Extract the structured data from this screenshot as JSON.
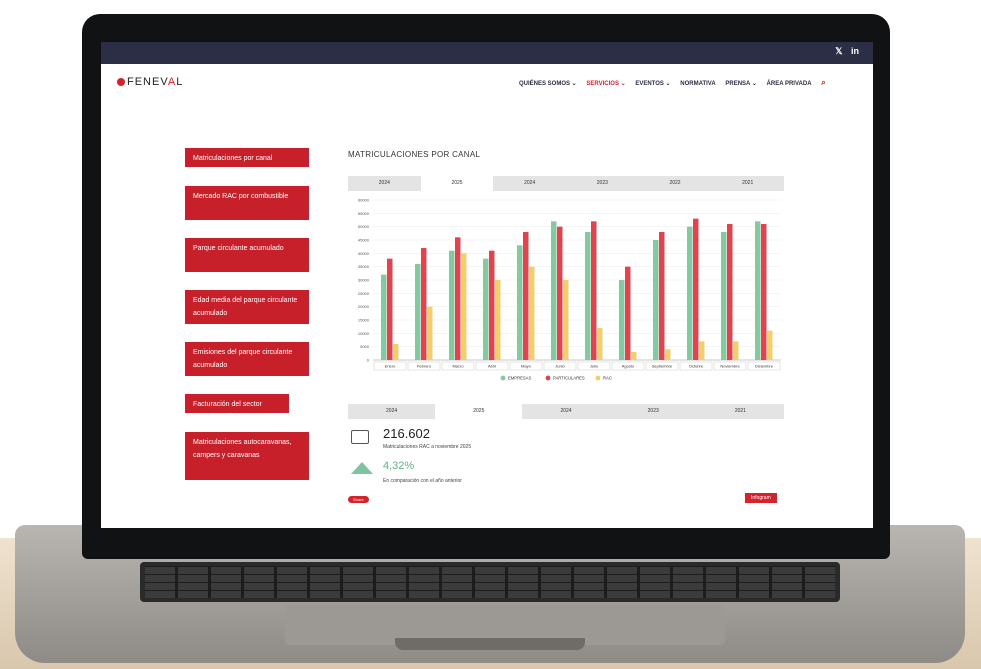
{
  "header": {
    "logo_mark": "●",
    "logo_text_1": "FENEV",
    "logo_text_a": "A",
    "logo_text_2": "L",
    "nav": [
      "QUIÉNES SOMOS ⌄",
      "SERVICIOS ⌄",
      "EVENTOS ⌄",
      "NORMATIVA",
      "PRENSA ⌄",
      "ÁREA PRIVADA",
      "⌕"
    ],
    "nav_active_index": 1
  },
  "social": [
    "𝕏",
    "in"
  ],
  "sidebar": {
    "items": [
      {
        "label": "Matriculaciones por canal"
      },
      {
        "label": "Mercado RAC por combustible"
      },
      {
        "label": "Parque circulante acumulado"
      },
      {
        "label": "Edad media del parque circulante acumulado"
      },
      {
        "label": "Emisiones del parque circulante acumulado"
      },
      {
        "label": "Facturación del sector"
      },
      {
        "label": "Matriculaciones autocaravanas, campers y caravanas"
      }
    ]
  },
  "panel": {
    "title": "MATRICULACIONES POR CANAL",
    "top_tabs": [
      "2024",
      "2025",
      "2024",
      "2023",
      "2022",
      "2021"
    ],
    "top_tab_selected": 1,
    "bottom_tabs": [
      "2024",
      "2025",
      "2024",
      "2023",
      "2021"
    ],
    "bottom_tab_selected": 1,
    "stat_value": "216.602",
    "stat_caption": "Matriculaciones RAC a noviembre 2025",
    "pct_value": "4,32%",
    "pct_caption": "En comparación con el año anterior",
    "share_label": "Share",
    "infogram_label": "Infogram"
  },
  "colors": {
    "empresas": "#85c9a0",
    "particulares": "#e0444f",
    "rac": "#f3cf6b",
    "accent": "#d4232b"
  },
  "chart_data": {
    "type": "bar",
    "categories": [
      "Enero",
      "Febrero",
      "Marzo",
      "Abril",
      "Mayo",
      "Junio",
      "Julio",
      "Agosto",
      "Septiembre",
      "Octubre",
      "Noviembre",
      "Diciembre"
    ],
    "series": [
      {
        "name": "EMPRESAS",
        "values": [
          32000,
          36000,
          41000,
          38000,
          43000,
          52000,
          48000,
          30000,
          45000,
          50000,
          48000,
          52000
        ]
      },
      {
        "name": "PARTICULARES",
        "values": [
          38000,
          42000,
          46000,
          41000,
          48000,
          50000,
          52000,
          35000,
          48000,
          53000,
          51000,
          51000
        ]
      },
      {
        "name": "RAC",
        "values": [
          6000,
          20000,
          40000,
          30000,
          35000,
          30000,
          12000,
          3000,
          4000,
          7000,
          7000,
          11000
        ]
      }
    ],
    "y_ticks": [
      "0",
      "5000",
      "10000",
      "15000",
      "20000",
      "25000",
      "30000",
      "35000",
      "40000",
      "45000",
      "50000",
      "55000",
      "60000"
    ],
    "ylim": [
      0,
      60000
    ],
    "grid": true,
    "legend": "bottom"
  }
}
